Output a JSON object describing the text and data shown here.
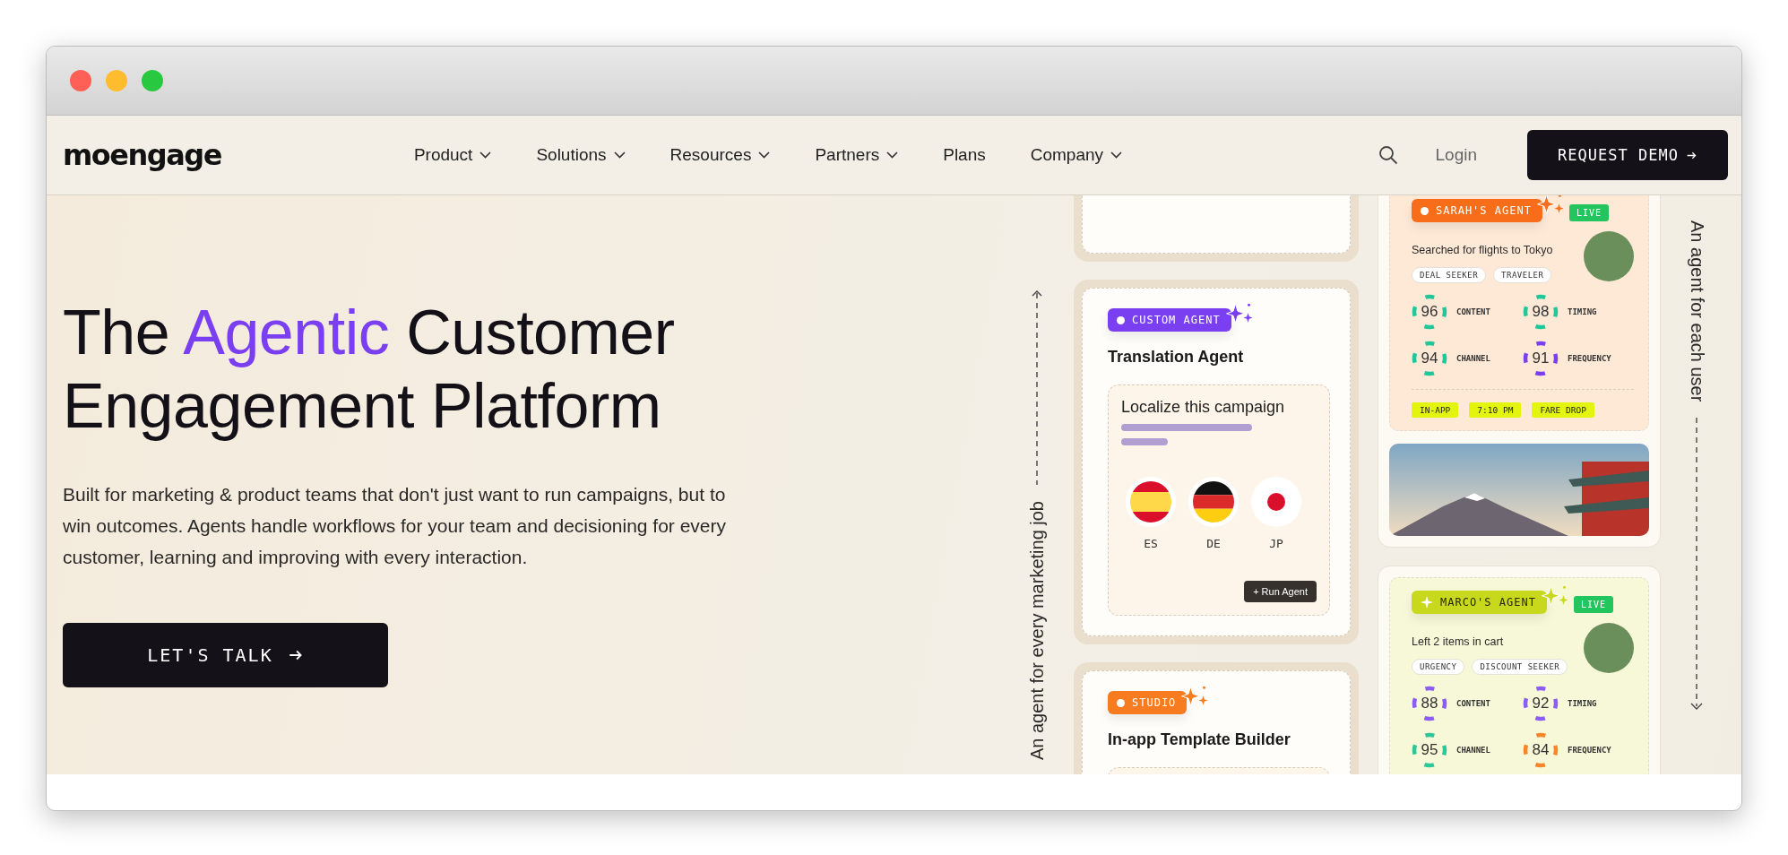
{
  "nav": {
    "logo": "moengage",
    "items": [
      {
        "label": "Product",
        "has_menu": true
      },
      {
        "label": "Solutions",
        "has_menu": true
      },
      {
        "label": "Resources",
        "has_menu": true
      },
      {
        "label": "Partners",
        "has_menu": true
      },
      {
        "label": "Plans",
        "has_menu": false
      },
      {
        "label": "Company",
        "has_menu": true
      }
    ],
    "login": "Login",
    "cta": "REQUEST DEMO"
  },
  "hero": {
    "headline": [
      {
        "text": "The ",
        "highlight": false
      },
      {
        "text": "Agentic",
        "highlight": true
      },
      {
        "text": " Customer Engagement Platform",
        "highlight": false
      }
    ],
    "description": "Built for marketing & product teams that don't just want to run campaigns, but to win outcomes. Agents handle workflows for your team and decisioning for every customer, learning and improving with every interaction.",
    "button": "LET'S TALK"
  },
  "showcase": {
    "left_label": "An agent for every marketing job",
    "right_label": "An agent for each user",
    "job_cards": [
      {
        "kind": "blank"
      },
      {
        "kind": "translation",
        "badge": "CUSTOM AGENT",
        "color": "#7b3ff2",
        "title": "Translation Agent",
        "prompt": "Localize this campaign",
        "languages": [
          {
            "code": "ES",
            "kind": "spain"
          },
          {
            "code": "DE",
            "kind": "germany"
          },
          {
            "code": "JP",
            "kind": "japan"
          }
        ],
        "action": "+ Run Agent"
      },
      {
        "kind": "studio",
        "badge": "STUDIO",
        "color": "#f77b1f",
        "title": "In-app Template Builder"
      }
    ],
    "user_cards": [
      {
        "badge": "SARAH'S AGENT",
        "kind": "dot",
        "color": "#f76d1a",
        "status": "LIVE",
        "event": "Searched for flights to Tokyo",
        "tags": [
          "DEAL SEEKER",
          "TRAVELER"
        ],
        "scores": [
          {
            "value": "96",
            "label": "CONTENT",
            "color": "#1fc79a"
          },
          {
            "value": "98",
            "label": "TIMING",
            "color": "#1fc79a"
          },
          {
            "value": "94",
            "label": "CHANNEL",
            "color": "#1fc79a"
          },
          {
            "value": "91",
            "label": "FREQUENCY",
            "color": "#7b3ff2"
          }
        ],
        "chips": [
          "IN-APP",
          "7:10 PM",
          "FARE DROP"
        ],
        "attachment": {
          "kind": "photo"
        }
      },
      {
        "badge": "MARCO'S AGENT",
        "kind": "sparkle",
        "color": "#c8d81c",
        "status": "LIVE",
        "event": "Left 2 items in cart",
        "tags": [
          "URGENCY",
          "DISCOUNT SEEKER"
        ],
        "scores": [
          {
            "value": "88",
            "label": "CONTENT",
            "color": "#8b5cf6"
          },
          {
            "value": "92",
            "label": "TIMING",
            "color": "#8b5cf6"
          },
          {
            "value": "95",
            "label": "CHANNEL",
            "color": "#2cc79b"
          },
          {
            "value": "84",
            "label": "FREQUENCY",
            "color": "#f7852a"
          }
        ]
      }
    ]
  }
}
